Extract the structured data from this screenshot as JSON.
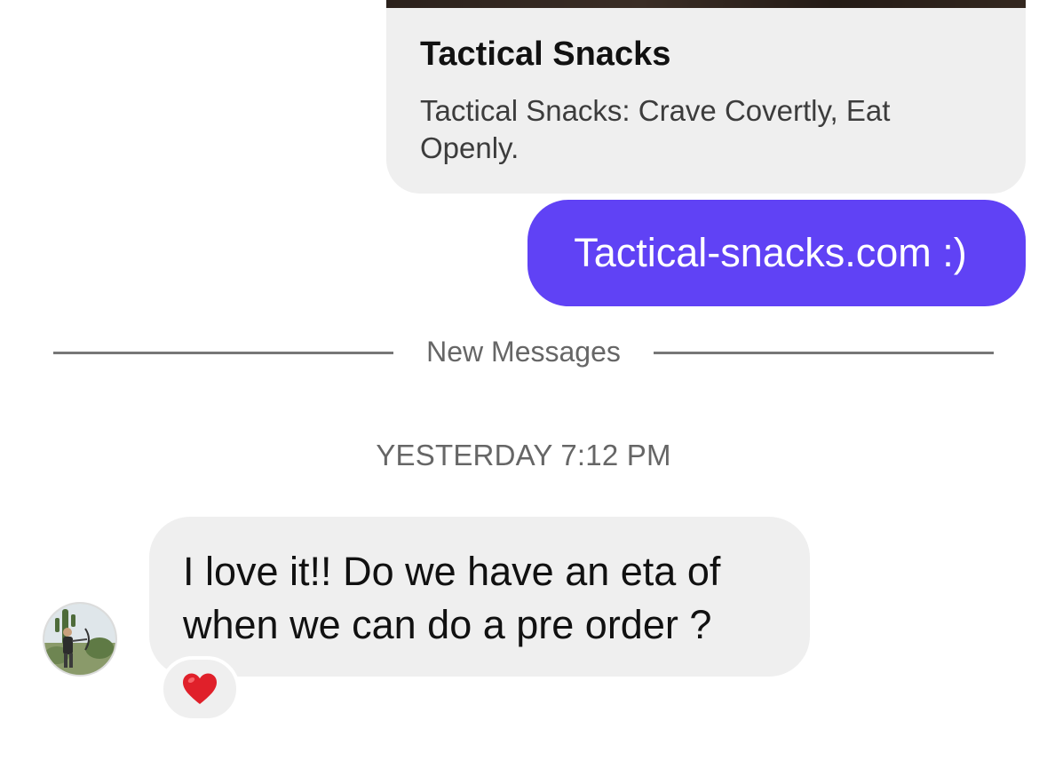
{
  "link_preview": {
    "title": "Tactical Snacks",
    "description": "Tactical Snacks: Crave Covertly, Eat Openly."
  },
  "outgoing_message": {
    "text": "Tactical-snacks.com :)"
  },
  "divider": {
    "label": "New Messages"
  },
  "timestamp": "YESTERDAY 7:12 PM",
  "incoming_message": {
    "text": "I love it!! Do we have an eta of when we can do a pre order ?",
    "reaction_icon": "red-heart-icon"
  },
  "colors": {
    "outgoing_bubble": "#6042f5",
    "incoming_bubble": "#efefef",
    "divider": "#777777",
    "reaction_heart": "#e0202a"
  }
}
